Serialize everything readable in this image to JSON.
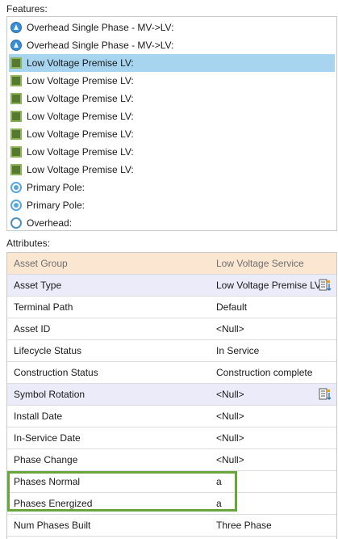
{
  "features": {
    "label": "Features:",
    "items": [
      {
        "label": "Overhead Single Phase - MV->LV:",
        "icon": "overhead-line-icon",
        "selected": false
      },
      {
        "label": "Overhead Single Phase - MV->LV:",
        "icon": "overhead-line-icon",
        "selected": false
      },
      {
        "label": "Low Voltage Premise LV:",
        "icon": "premise-square-icon",
        "selected": true
      },
      {
        "label": "Low Voltage Premise LV:",
        "icon": "premise-square-icon",
        "selected": false
      },
      {
        "label": "Low Voltage Premise LV:",
        "icon": "premise-square-icon",
        "selected": false
      },
      {
        "label": "Low Voltage Premise LV:",
        "icon": "premise-square-icon",
        "selected": false
      },
      {
        "label": "Low Voltage Premise LV:",
        "icon": "premise-square-icon",
        "selected": false
      },
      {
        "label": "Low Voltage Premise LV:",
        "icon": "premise-square-icon",
        "selected": false
      },
      {
        "label": "Low Voltage Premise LV:",
        "icon": "premise-square-icon",
        "selected": false
      },
      {
        "label": "Primary Pole:",
        "icon": "pole-icon",
        "selected": false
      },
      {
        "label": "Primary Pole:",
        "icon": "pole-icon",
        "selected": false
      },
      {
        "label": "Overhead:",
        "icon": "overhead-circle-icon",
        "selected": false
      }
    ]
  },
  "attributes": {
    "label": "Attributes:",
    "rows": [
      {
        "name": "Asset Group",
        "value": "Low Voltage Service",
        "style": "header"
      },
      {
        "name": "Asset Type",
        "value": "Low Voltage Premise LV",
        "style": "editable",
        "icon": "list-edit-icon"
      },
      {
        "name": "Terminal Path",
        "value": "Default",
        "style": "normal"
      },
      {
        "name": "Asset ID",
        "value": "<Null>",
        "style": "normal"
      },
      {
        "name": "Lifecycle Status",
        "value": "In Service",
        "style": "normal"
      },
      {
        "name": "Construction Status",
        "value": "Construction complete",
        "style": "normal"
      },
      {
        "name": "Symbol Rotation",
        "value": "<Null>",
        "style": "editable",
        "icon": "list-edit-icon"
      },
      {
        "name": "Install Date",
        "value": "<Null>",
        "style": "normal"
      },
      {
        "name": "In-Service Date",
        "value": "<Null>",
        "style": "normal"
      },
      {
        "name": "Phase Change",
        "value": "<Null>",
        "style": "normal"
      },
      {
        "name": "Phases Normal",
        "value": "a",
        "style": "normal"
      },
      {
        "name": "Phases Energized",
        "value": "a",
        "style": "normal"
      },
      {
        "name": "Num Phases Built",
        "value": "Three Phase",
        "style": "normal"
      }
    ]
  },
  "colors": {
    "selection": "#a7d5f0",
    "header_row": "#fbe6d2",
    "editable_row": "#ecebfa",
    "highlight": "#6aa43c"
  }
}
